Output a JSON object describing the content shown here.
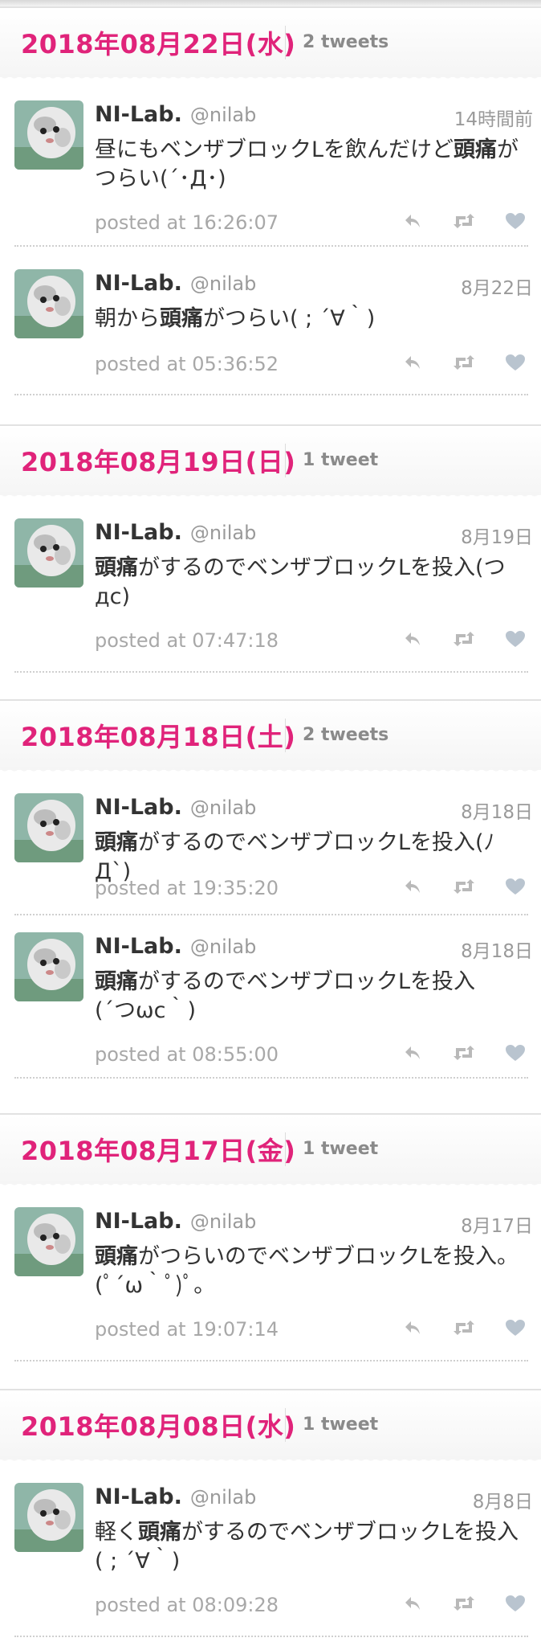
{
  "user": {
    "name": "NI-Lab.",
    "handle": "@nilab"
  },
  "days": [
    {
      "date": "2018年08月22日(水)",
      "count": "2 tweets",
      "tweets": [
        {
          "time": "14時間前",
          "pre": "昼にもベンザブロックLを飲んだけど",
          "bold": "頭痛",
          "post": "が\nつらい(´･Д･)",
          "posted": "posted at 16:26:07"
        },
        {
          "time": "8月22日",
          "pre": "朝から",
          "bold": "頭痛",
          "post": "がつらい( ; ´∀｀)",
          "posted": "posted at 05:36:52"
        }
      ]
    },
    {
      "date": "2018年08月19日(日)",
      "count": "1 tweet",
      "tweets": [
        {
          "time": "8月19日",
          "pre": "",
          "bold": "頭痛",
          "post": "がするのでベンザブロックLを投入(つ\nдc)",
          "posted": "posted at 07:47:18"
        }
      ]
    },
    {
      "date": "2018年08月18日(土)",
      "count": "2 tweets",
      "tweets": [
        {
          "time": "8月18日",
          "pre": "",
          "bold": "頭痛",
          "post": "がするのでベンザブロックLを投入(ﾉД`)",
          "posted": "posted at 19:35:20"
        },
        {
          "time": "8月18日",
          "pre": "",
          "bold": "頭痛",
          "post": "がするのでベンザブロックLを投入\n(´つωc｀)",
          "posted": "posted at 08:55:00"
        }
      ]
    },
    {
      "date": "2018年08月17日(金)",
      "count": "1 tweet",
      "tweets": [
        {
          "time": "8月17日",
          "pre": "",
          "bold": "頭痛",
          "post": "がつらいのでベンザブロックLを投入。\n(ﾟ´ω｀ﾟ)ﾟ。",
          "posted": "posted at 19:07:14"
        }
      ]
    },
    {
      "date": "2018年08月08日(水)",
      "count": "1 tweet",
      "tweets": [
        {
          "time": "8月8日",
          "pre": "軽く",
          "bold": "頭痛",
          "post": "がするのでベンザブロックLを投入\n( ; ´∀｀)",
          "posted": "posted at 08:09:28"
        }
      ]
    }
  ],
  "icons": {
    "reply": "reply-icon",
    "retweet": "retweet-icon",
    "like": "heart-icon"
  },
  "colors": {
    "accent": "#e0237a",
    "muted": "#a8a8a8"
  }
}
